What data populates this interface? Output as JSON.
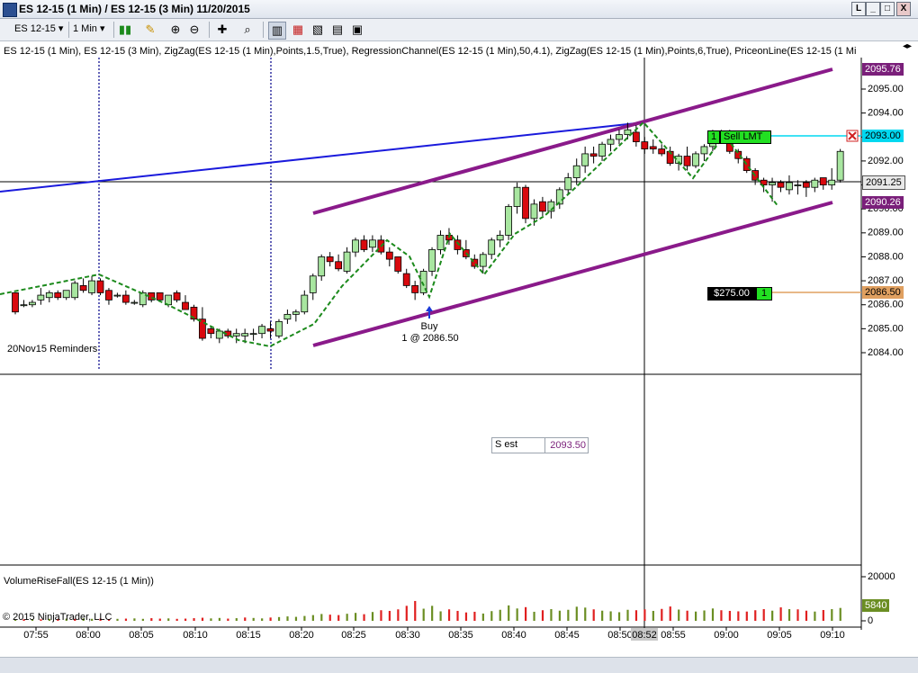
{
  "window": {
    "title": "ES 12-15 (1 Min) / ES 12-15 (3 Min)  11/20/2015",
    "minimize": "_",
    "restore": "L",
    "maximize": "□",
    "close": "X"
  },
  "toolbar": {
    "instrument": "ES 12-15",
    "interval": "1 Min"
  },
  "indicators_label": "ES 12-15 (1 Min), ES 12-15 (3 Min), ZigZag(ES 12-15 (1 Min),Points,1.5,True), RegressionChannel(ES 12-15 (1 Min),50,4.1), ZigZag(ES 12-15 (1 Min),Points,6,True), PriceonLine(ES 12-15 (1 Mi",
  "chart_data": {
    "type": "candlestick",
    "instrument": "ES 12-15",
    "y_axis": [
      "2095.00",
      "2094.00",
      "2093.00",
      "2092.00",
      "2091.00",
      "2090.00",
      "2089.00",
      "2088.00",
      "2087.00",
      "2086.00",
      "2085.00",
      "2084.00"
    ],
    "ylim": [
      2083.5,
      2096.2
    ],
    "x_axis": [
      "07:55",
      "08:00",
      "08:05",
      "08:10",
      "08:15",
      "08:20",
      "08:25",
      "08:30",
      "08:35",
      "08:40",
      "08:45",
      "08:50",
      "08:52",
      "08:55",
      "09:00",
      "09:05",
      "09:10"
    ],
    "price_badges": {
      "upper_channel": "2095.76",
      "sell_limit": "2093.00",
      "last_price": "2091.25",
      "lower_channel": "2090.26",
      "position_entry": "2086.50"
    },
    "candles": [
      {
        "o": 2086.5,
        "h": 2086.5,
        "l": 2085.6,
        "c": 2085.7
      },
      {
        "o": 2086.0,
        "h": 2086.2,
        "l": 2085.9,
        "c": 2086.0
      },
      {
        "o": 2086.0,
        "h": 2086.2,
        "l": 2085.9,
        "c": 2086.1
      },
      {
        "o": 2086.2,
        "h": 2086.7,
        "l": 2086.0,
        "c": 2086.4
      },
      {
        "o": 2086.3,
        "h": 2086.6,
        "l": 2086.1,
        "c": 2086.5
      },
      {
        "o": 2086.5,
        "h": 2086.6,
        "l": 2086.2,
        "c": 2086.3
      },
      {
        "o": 2086.3,
        "h": 2086.6,
        "l": 2086.2,
        "c": 2086.6
      },
      {
        "o": 2086.3,
        "h": 2087.0,
        "l": 2086.2,
        "c": 2086.9
      },
      {
        "o": 2086.8,
        "h": 2087.1,
        "l": 2086.5,
        "c": 2086.6
      },
      {
        "o": 2086.5,
        "h": 2087.2,
        "l": 2086.4,
        "c": 2087.0
      },
      {
        "o": 2087.0,
        "h": 2087.1,
        "l": 2086.4,
        "c": 2086.5
      },
      {
        "o": 2086.6,
        "h": 2086.7,
        "l": 2086.0,
        "c": 2086.2
      },
      {
        "o": 2086.4,
        "h": 2086.5,
        "l": 2086.3,
        "c": 2086.4
      },
      {
        "o": 2086.4,
        "h": 2086.6,
        "l": 2086.0,
        "c": 2086.1
      },
      {
        "o": 2086.1,
        "h": 2086.2,
        "l": 2086.0,
        "c": 2086.1
      },
      {
        "o": 2086.0,
        "h": 2086.6,
        "l": 2085.9,
        "c": 2086.5
      },
      {
        "o": 2086.5,
        "h": 2086.5,
        "l": 2086.1,
        "c": 2086.2
      },
      {
        "o": 2086.5,
        "h": 2086.5,
        "l": 2086.2,
        "c": 2086.2
      },
      {
        "o": 2086.0,
        "h": 2086.4,
        "l": 2085.9,
        "c": 2086.4
      },
      {
        "o": 2086.5,
        "h": 2086.6,
        "l": 2086.1,
        "c": 2086.2
      },
      {
        "o": 2086.1,
        "h": 2086.4,
        "l": 2085.8,
        "c": 2085.8
      },
      {
        "o": 2085.9,
        "h": 2086.0,
        "l": 2085.3,
        "c": 2085.4
      },
      {
        "o": 2085.4,
        "h": 2085.9,
        "l": 2084.5,
        "c": 2084.6
      },
      {
        "o": 2085.0,
        "h": 2085.1,
        "l": 2084.6,
        "c": 2084.8
      },
      {
        "o": 2084.6,
        "h": 2085.0,
        "l": 2084.4,
        "c": 2084.9
      },
      {
        "o": 2084.9,
        "h": 2085.0,
        "l": 2084.6,
        "c": 2084.7
      },
      {
        "o": 2084.7,
        "h": 2085.0,
        "l": 2084.4,
        "c": 2084.8
      },
      {
        "o": 2084.7,
        "h": 2085.0,
        "l": 2084.4,
        "c": 2084.8
      },
      {
        "o": 2084.8,
        "h": 2085.0,
        "l": 2084.5,
        "c": 2084.8
      },
      {
        "o": 2084.8,
        "h": 2085.2,
        "l": 2084.6,
        "c": 2085.1
      },
      {
        "o": 2085.0,
        "h": 2085.3,
        "l": 2084.6,
        "c": 2084.9
      },
      {
        "o": 2084.7,
        "h": 2085.4,
        "l": 2084.6,
        "c": 2085.3
      },
      {
        "o": 2085.4,
        "h": 2085.8,
        "l": 2085.2,
        "c": 2085.6
      },
      {
        "o": 2085.6,
        "h": 2085.8,
        "l": 2085.3,
        "c": 2085.7
      },
      {
        "o": 2085.7,
        "h": 2086.6,
        "l": 2085.6,
        "c": 2086.4
      },
      {
        "o": 2086.5,
        "h": 2087.3,
        "l": 2086.2,
        "c": 2087.2
      },
      {
        "o": 2087.2,
        "h": 2088.1,
        "l": 2087.0,
        "c": 2088.0
      },
      {
        "o": 2088.0,
        "h": 2088.2,
        "l": 2087.6,
        "c": 2087.8
      },
      {
        "o": 2087.8,
        "h": 2088.1,
        "l": 2087.4,
        "c": 2087.5
      },
      {
        "o": 2087.4,
        "h": 2088.4,
        "l": 2087.3,
        "c": 2088.2
      },
      {
        "o": 2088.2,
        "h": 2088.8,
        "l": 2088.0,
        "c": 2088.7
      },
      {
        "o": 2088.7,
        "h": 2088.9,
        "l": 2088.2,
        "c": 2088.3
      },
      {
        "o": 2088.4,
        "h": 2088.9,
        "l": 2088.2,
        "c": 2088.7
      },
      {
        "o": 2088.7,
        "h": 2088.9,
        "l": 2088.1,
        "c": 2088.2
      },
      {
        "o": 2088.2,
        "h": 2088.4,
        "l": 2087.6,
        "c": 2087.9
      },
      {
        "o": 2088.0,
        "h": 2088.0,
        "l": 2087.3,
        "c": 2087.4
      },
      {
        "o": 2087.3,
        "h": 2087.5,
        "l": 2086.7,
        "c": 2086.8
      },
      {
        "o": 2086.8,
        "h": 2087.0,
        "l": 2086.2,
        "c": 2086.5
      },
      {
        "o": 2086.5,
        "h": 2087.5,
        "l": 2086.4,
        "c": 2087.4
      },
      {
        "o": 2087.4,
        "h": 2088.4,
        "l": 2087.2,
        "c": 2088.3
      },
      {
        "o": 2088.3,
        "h": 2089.1,
        "l": 2088.1,
        "c": 2088.9
      },
      {
        "o": 2088.9,
        "h": 2089.2,
        "l": 2088.5,
        "c": 2088.7
      },
      {
        "o": 2088.7,
        "h": 2088.9,
        "l": 2088.1,
        "c": 2088.3
      },
      {
        "o": 2088.3,
        "h": 2088.7,
        "l": 2087.9,
        "c": 2088.0
      },
      {
        "o": 2087.9,
        "h": 2088.1,
        "l": 2087.5,
        "c": 2087.6
      },
      {
        "o": 2087.6,
        "h": 2088.2,
        "l": 2087.3,
        "c": 2088.1
      },
      {
        "o": 2088.1,
        "h": 2088.8,
        "l": 2087.9,
        "c": 2088.7
      },
      {
        "o": 2088.7,
        "h": 2089.1,
        "l": 2088.4,
        "c": 2088.9
      },
      {
        "o": 2088.9,
        "h": 2090.2,
        "l": 2088.7,
        "c": 2090.1
      },
      {
        "o": 2090.1,
        "h": 2091.1,
        "l": 2089.8,
        "c": 2090.9
      },
      {
        "o": 2090.9,
        "h": 2091.0,
        "l": 2089.4,
        "c": 2089.6
      },
      {
        "o": 2089.6,
        "h": 2090.4,
        "l": 2089.3,
        "c": 2090.2
      },
      {
        "o": 2090.3,
        "h": 2090.5,
        "l": 2089.7,
        "c": 2089.9
      },
      {
        "o": 2089.9,
        "h": 2090.4,
        "l": 2089.6,
        "c": 2090.3
      },
      {
        "o": 2090.2,
        "h": 2090.9,
        "l": 2090.0,
        "c": 2090.8
      },
      {
        "o": 2090.8,
        "h": 2091.5,
        "l": 2090.6,
        "c": 2091.3
      },
      {
        "o": 2091.3,
        "h": 2092.1,
        "l": 2091.0,
        "c": 2091.8
      },
      {
        "o": 2091.8,
        "h": 2092.6,
        "l": 2091.5,
        "c": 2092.3
      },
      {
        "o": 2092.3,
        "h": 2092.6,
        "l": 2091.9,
        "c": 2092.2
      },
      {
        "o": 2092.2,
        "h": 2092.8,
        "l": 2092.0,
        "c": 2092.7
      },
      {
        "o": 2092.7,
        "h": 2093.1,
        "l": 2092.4,
        "c": 2092.9
      },
      {
        "o": 2092.9,
        "h": 2093.3,
        "l": 2092.7,
        "c": 2093.1
      },
      {
        "o": 2093.1,
        "h": 2093.6,
        "l": 2092.9,
        "c": 2093.3
      },
      {
        "o": 2093.2,
        "h": 2093.5,
        "l": 2092.6,
        "c": 2092.8
      },
      {
        "o": 2092.8,
        "h": 2093.0,
        "l": 2092.3,
        "c": 2092.5
      },
      {
        "o": 2092.6,
        "h": 2092.9,
        "l": 2092.3,
        "c": 2092.5
      },
      {
        "o": 2092.5,
        "h": 2092.7,
        "l": 2092.2,
        "c": 2092.3
      },
      {
        "o": 2092.4,
        "h": 2092.6,
        "l": 2091.8,
        "c": 2091.9
      },
      {
        "o": 2091.9,
        "h": 2092.3,
        "l": 2091.6,
        "c": 2092.2
      },
      {
        "o": 2092.2,
        "h": 2092.6,
        "l": 2091.6,
        "c": 2091.8
      },
      {
        "o": 2091.8,
        "h": 2092.4,
        "l": 2091.7,
        "c": 2092.3
      },
      {
        "o": 2092.3,
        "h": 2092.7,
        "l": 2092.0,
        "c": 2092.6
      },
      {
        "o": 2092.6,
        "h": 2093.3,
        "l": 2092.4,
        "c": 2093.1
      },
      {
        "o": 2093.1,
        "h": 2093.3,
        "l": 2092.8,
        "c": 2092.9
      },
      {
        "o": 2093.0,
        "h": 2093.3,
        "l": 2092.3,
        "c": 2092.4
      },
      {
        "o": 2092.4,
        "h": 2092.5,
        "l": 2091.9,
        "c": 2092.1
      },
      {
        "o": 2092.1,
        "h": 2092.2,
        "l": 2091.5,
        "c": 2091.6
      },
      {
        "o": 2091.6,
        "h": 2091.7,
        "l": 2091.0,
        "c": 2091.2
      },
      {
        "o": 2091.2,
        "h": 2091.3,
        "l": 2090.7,
        "c": 2091.0
      },
      {
        "o": 2091.0,
        "h": 2091.3,
        "l": 2090.3,
        "c": 2091.1
      },
      {
        "o": 2091.1,
        "h": 2091.2,
        "l": 2090.7,
        "c": 2090.9
      },
      {
        "o": 2090.8,
        "h": 2091.4,
        "l": 2090.6,
        "c": 2091.1
      },
      {
        "o": 2091.0,
        "h": 2091.2,
        "l": 2090.6,
        "c": 2091.0
      },
      {
        "o": 2091.1,
        "h": 2091.2,
        "l": 2090.5,
        "c": 2090.9
      },
      {
        "o": 2090.9,
        "h": 2091.3,
        "l": 2090.7,
        "c": 2091.2
      },
      {
        "o": 2091.3,
        "h": 2091.3,
        "l": 2090.8,
        "c": 2091.0
      },
      {
        "o": 2091.0,
        "h": 2091.7,
        "l": 2090.8,
        "c": 2091.2
      },
      {
        "o": 2091.2,
        "h": 2092.5,
        "l": 2091.1,
        "c": 2092.4
      }
    ],
    "volume": {
      "axis": [
        "20000",
        "0"
      ],
      "last_value": "5840",
      "values": [
        600,
        700,
        800,
        700,
        900,
        800,
        1000,
        900,
        1100,
        900,
        1000,
        800,
        900,
        1000,
        1100,
        900,
        1200,
        1000,
        1100,
        900,
        1000,
        1200,
        1400,
        1100,
        1300,
        1000,
        1200,
        1500,
        1300,
        1100,
        1500,
        1700,
        2000,
        1800,
        2200,
        2600,
        3100,
        2800,
        2600,
        3200,
        3600,
        3000,
        4000,
        4800,
        4500,
        5200,
        6800,
        9000,
        5500,
        6800,
        4300,
        5200,
        4500,
        3800,
        4100,
        3300,
        4400,
        5000,
        7000,
        5600,
        6200,
        4100,
        4800,
        5300,
        4600,
        5000,
        6400,
        6000,
        5200,
        4600,
        4300,
        3900,
        5000,
        4800,
        5200,
        4500,
        5400,
        6500,
        5100,
        4600,
        4200,
        4700,
        5600,
        4800,
        4500,
        4300,
        4200,
        4800,
        5300,
        4600,
        6100,
        5300,
        5200,
        4600,
        4200,
        4900,
        5300,
        5840
      ],
      "direction": [
        "u",
        "d",
        "u",
        "d",
        "u",
        "d",
        "u",
        "d",
        "u",
        "u",
        "d",
        "d",
        "u",
        "d",
        "u",
        "u",
        "d",
        "d",
        "u",
        "d",
        "d",
        "d",
        "d",
        "u",
        "u",
        "d",
        "u",
        "d",
        "u",
        "u",
        "d",
        "u",
        "u",
        "u",
        "u",
        "u",
        "u",
        "d",
        "d",
        "u",
        "u",
        "d",
        "u",
        "d",
        "d",
        "d",
        "d",
        "d",
        "u",
        "u",
        "u",
        "d",
        "d",
        "d",
        "d",
        "u",
        "u",
        "u",
        "u",
        "u",
        "d",
        "u",
        "d",
        "u",
        "u",
        "u",
        "u",
        "u",
        "d",
        "u",
        "u",
        "u",
        "u",
        "d",
        "d",
        "u",
        "d",
        "d",
        "u",
        "d",
        "u",
        "u",
        "u",
        "d",
        "d",
        "d",
        "d",
        "d",
        "d",
        "u",
        "d",
        "u",
        "d",
        "d",
        "u",
        "d",
        "u",
        "u"
      ]
    }
  },
  "orders": {
    "sell": {
      "qty": "1",
      "label": "Sell LMT"
    },
    "position": {
      "pnl": "$275.00",
      "qty": "1"
    },
    "buy": {
      "label": "Buy",
      "fill": "1 @ 2086.50"
    }
  },
  "reminders_label": "20Nov15 Reminders",
  "sest": {
    "label": "S est",
    "value": "2093.50"
  },
  "volume_label": "VolumeRiseFall(ES 12-15 (1 Min))",
  "copyright": "© 2015 NinjaTrader, LLC",
  "colors": {
    "up_candle": "#a8e6a0",
    "down_candle": "#d9090e",
    "zigzag": "#1c8a1c",
    "channel": "#8a1a8a",
    "blue_line": "#1a1adc",
    "vol_up": "#6b8e23",
    "vol_down": "#e02020",
    "sell_line": "#00d8f0",
    "position_line": "#e0a060"
  }
}
